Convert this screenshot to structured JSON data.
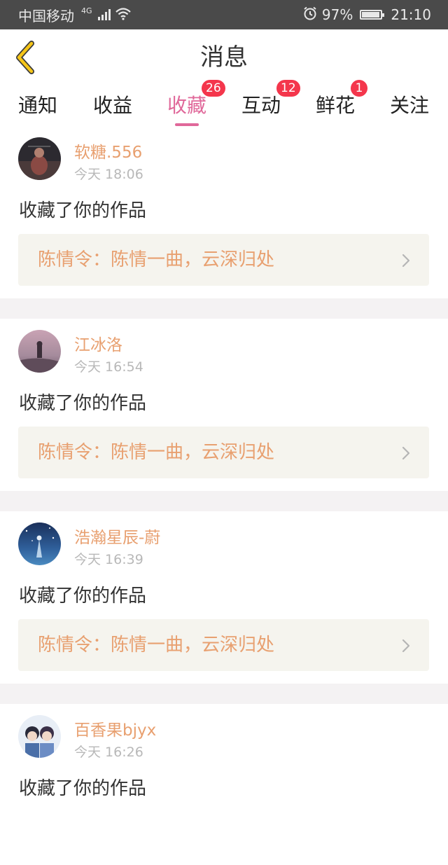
{
  "status_bar": {
    "carrier": "中国移动",
    "network": "4G",
    "battery": "97%",
    "battery_level": 0.97,
    "time": "21:10"
  },
  "header": {
    "title": "消息"
  },
  "tabs": [
    {
      "label": "通知",
      "badge": null,
      "active": false
    },
    {
      "label": "收益",
      "badge": null,
      "active": false
    },
    {
      "label": "收藏",
      "badge": "26",
      "active": true
    },
    {
      "label": "互动",
      "badge": "12",
      "active": false
    },
    {
      "label": "鲜花",
      "badge": "1",
      "active": false
    },
    {
      "label": "关注",
      "badge": null,
      "active": false
    }
  ],
  "messages": [
    {
      "user": "软糖.556",
      "time": "今天 18:06",
      "action": "收藏了你的作品",
      "work": "陈情令：陈情一曲，云深归处"
    },
    {
      "user": "江冰洛",
      "time": "今天 16:54",
      "action": "收藏了你的作品",
      "work": "陈情令：陈情一曲，云深归处"
    },
    {
      "user": "浩瀚星辰-蔚",
      "time": "今天 16:39",
      "action": "收藏了你的作品",
      "work": "陈情令：陈情一曲，云深归处"
    },
    {
      "user": "百香果bjyx",
      "time": "今天 16:26",
      "action": "收藏了你的作品",
      "work": ""
    }
  ],
  "colors": {
    "accent": "#e0689a",
    "badge": "#f4364c",
    "username": "#e8a070",
    "back_icon": "#f5c518"
  },
  "icons": {
    "back": "chevron-left-icon",
    "work_link": "chevron-right-icon",
    "signal": "signal-icon",
    "wifi": "wifi-icon",
    "alarm": "alarm-icon",
    "battery": "battery-icon"
  }
}
